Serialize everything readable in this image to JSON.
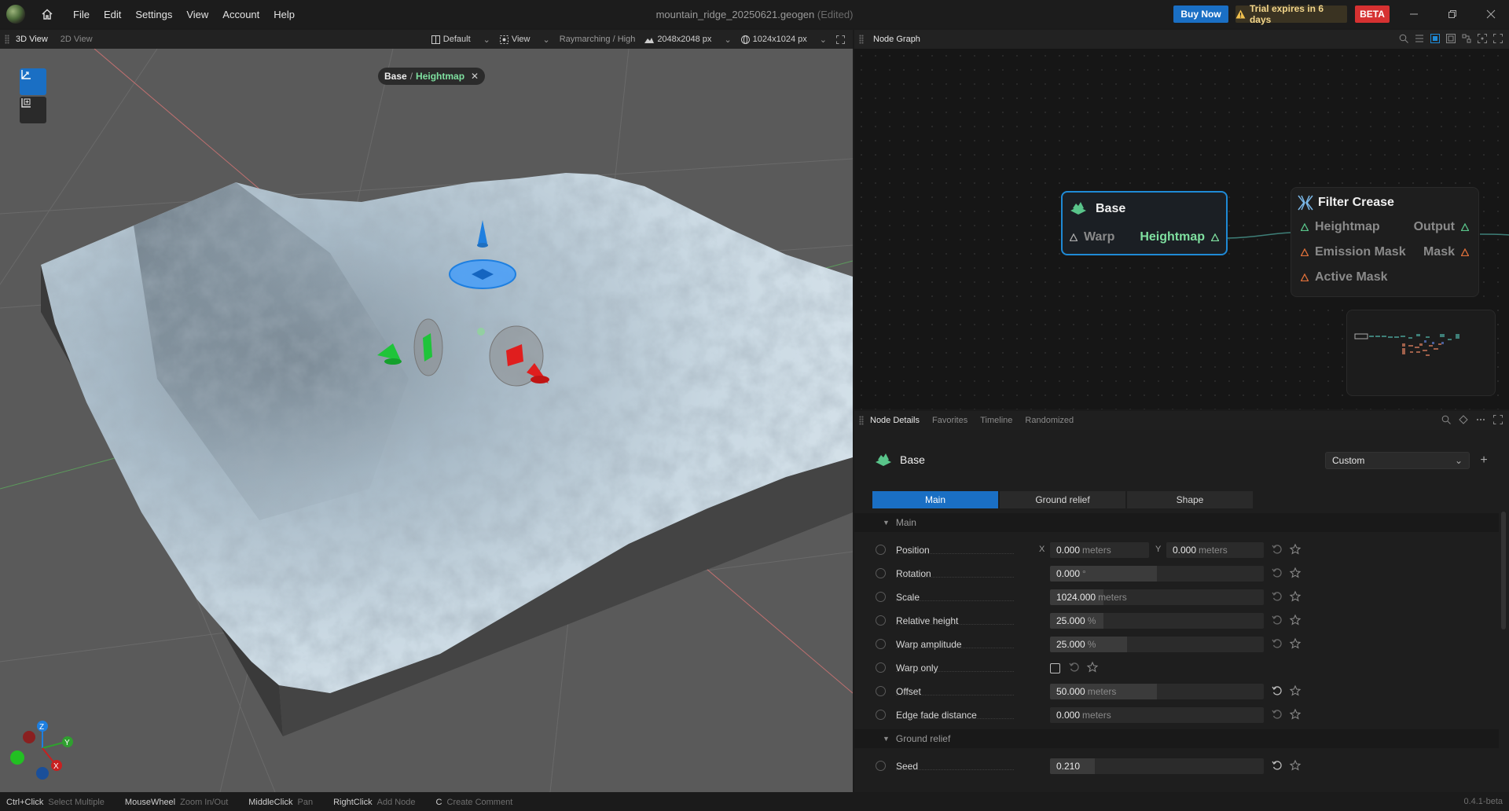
{
  "titlebar": {
    "menu": [
      "File",
      "Edit",
      "Settings",
      "View",
      "Account",
      "Help"
    ],
    "file_name": "mountain_ridge_20250621.geogen",
    "edited_tag": "(Edited)",
    "buy_now": "Buy Now",
    "trial": "Trial expires in 6 days",
    "beta": "BETA"
  },
  "viewport_panel": {
    "tabs": [
      "3D View",
      "2D View"
    ],
    "tools": {
      "layout": "Default",
      "view": "View",
      "render": "Raymarching / High",
      "resolution": "2048x2048 px",
      "preview_res": "1024x1024 px"
    },
    "breadcrumb": {
      "parent": "Base",
      "separator": "/",
      "leaf": "Heightmap"
    }
  },
  "node_graph": {
    "title": "Node Graph",
    "nodes": {
      "base": {
        "title": "Base",
        "input": "Warp",
        "output": "Heightmap"
      },
      "filter_crease": {
        "title": "Filter Crease",
        "inputs": [
          "Heightmap",
          "Emission Mask",
          "Active Mask"
        ],
        "outputs": [
          "Output",
          "Mask"
        ]
      }
    }
  },
  "node_details": {
    "tabs": [
      "Node Details",
      "Favorites",
      "Timeline",
      "Randomized"
    ],
    "node_name": "Base",
    "preset": "Custom",
    "segments": [
      "Main",
      "Ground relief",
      "Shape"
    ],
    "sections": {
      "main": "Main",
      "ground_relief": "Ground relief"
    },
    "params": {
      "position": {
        "label": "Position",
        "x_axis": "X",
        "x_value": "0.000",
        "y_axis": "Y",
        "y_value": "0.000",
        "unit": "meters"
      },
      "rotation": {
        "label": "Rotation",
        "value": "0.000",
        "unit": "°",
        "fraction": 0.5
      },
      "scale": {
        "label": "Scale",
        "value": "1024.000",
        "unit": "meters",
        "fraction": 0.25
      },
      "relative_height": {
        "label": "Relative height",
        "value": "25.000",
        "unit": "%",
        "fraction": 0.25
      },
      "warp_amplitude": {
        "label": "Warp amplitude",
        "value": "25.000",
        "unit": "%",
        "fraction": 0.36
      },
      "warp_only": {
        "label": "Warp only",
        "checked": false
      },
      "offset": {
        "label": "Offset",
        "value": "50.000",
        "unit": "meters",
        "fraction": 0.5
      },
      "edge_fade": {
        "label": "Edge fade distance",
        "value": "0.000",
        "unit": "meters",
        "fraction": 0.0
      },
      "seed": {
        "label": "Seed",
        "value": "0.210",
        "fraction": 0.21
      }
    }
  },
  "statusbar": {
    "hints": [
      {
        "key": "Ctrl+Click",
        "desc": "Select Multiple"
      },
      {
        "key": "MouseWheel",
        "desc": "Zoom In/Out"
      },
      {
        "key": "MiddleClick",
        "desc": "Pan"
      },
      {
        "key": "RightClick",
        "desc": "Add Node"
      },
      {
        "key": "C",
        "desc": "Create Comment"
      }
    ],
    "version": "0.4.1-beta"
  },
  "colors": {
    "accent": "#1a6fc4",
    "beta": "#d63131",
    "port_green": "#59c48a",
    "port_orange": "#e0703a"
  }
}
